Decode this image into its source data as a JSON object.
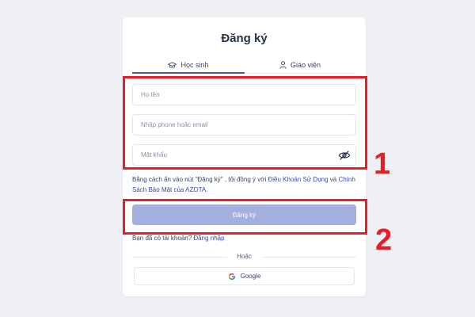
{
  "page": {
    "title": "Đăng ký"
  },
  "tabs": [
    {
      "label": "Học sinh",
      "active": true,
      "icon": "graduation-cap-icon"
    },
    {
      "label": "Giáo viên",
      "active": false,
      "icon": "user-icon"
    }
  ],
  "form": {
    "name_placeholder": "Họ tên",
    "contact_placeholder": "Nhập phone hoặc email",
    "password_placeholder": "Mật khẩu",
    "password_toggle_icon": "eye-off-icon"
  },
  "terms": {
    "prefix": "Bằng cách ấn vào nút \"Đăng ký\" , tôi đồng ý với ",
    "link1": "Điều Khoản Sử Dụng",
    "middle": " và ",
    "link2": "Chính Sách Bảo Mật của AZOTA",
    "suffix": "."
  },
  "submit_label": "Đăng ký",
  "login": {
    "prompt": "Bạn đã có tài khoản? ",
    "link": "Đăng nhập"
  },
  "divider_text": "Hoặc",
  "google_label": "Google",
  "annotations": {
    "marker1": "1",
    "marker2": "2",
    "color": "#ec1c24"
  },
  "colors": {
    "accent": "#4a58a8",
    "link": "#3448b4",
    "submit_bg": "#a3b0dd"
  }
}
